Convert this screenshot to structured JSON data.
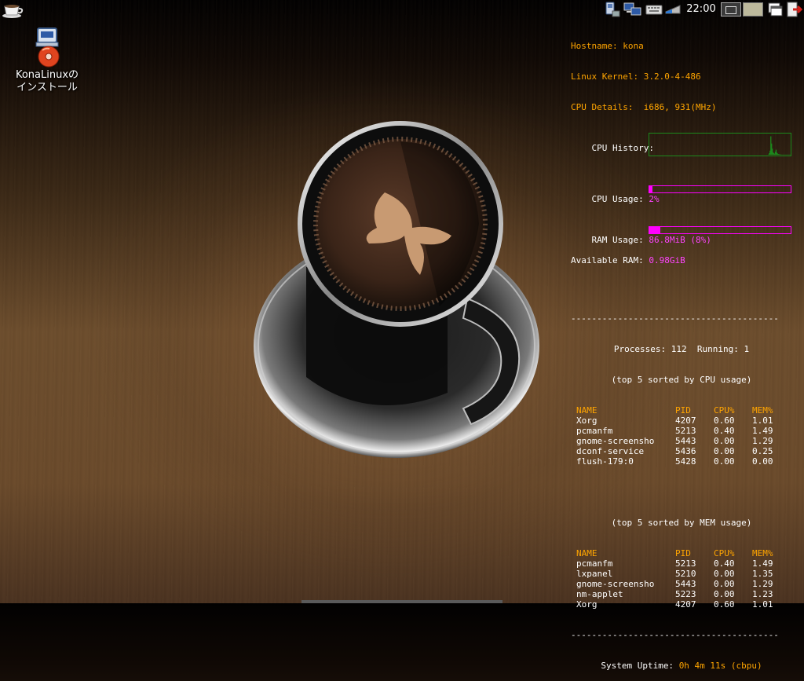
{
  "desktop": {
    "icon_label_line1": "KonaLinuxの",
    "icon_label_line2": "インストール"
  },
  "tray": {
    "clock": "22:00"
  },
  "conky": {
    "hostname_label": "Hostname:",
    "hostname": "kona",
    "kernel_label": "Linux Kernel:",
    "kernel": "3.2.0-4-486",
    "cpu_details_label": "CPU Details:",
    "cpu_details": "i686, 931(MHz)",
    "cpu_history_label": "CPU History:",
    "cpu_history": [
      0,
      0,
      0,
      0,
      0,
      0,
      0,
      0,
      0,
      0,
      0,
      0,
      0,
      0,
      0,
      0,
      0,
      0,
      0,
      0,
      0,
      0,
      0,
      0,
      0,
      0,
      0,
      0,
      0,
      0,
      0,
      0,
      0,
      0,
      0,
      0,
      0,
      0,
      0,
      0,
      0,
      0,
      0,
      0,
      0,
      0,
      0,
      0,
      0,
      0,
      0,
      0,
      0,
      0,
      0,
      0,
      0,
      0,
      0,
      0,
      0,
      0,
      0,
      0,
      0,
      0,
      0,
      0,
      0,
      0,
      0,
      0,
      0,
      0,
      0,
      0,
      0,
      0,
      0,
      0,
      0,
      0,
      0,
      0,
      0,
      0,
      0,
      0,
      0,
      0,
      0,
      0,
      0,
      0,
      0,
      0,
      0,
      0,
      0,
      0,
      0,
      0,
      0,
      0,
      0,
      0,
      0,
      0,
      0,
      0,
      0,
      0,
      0,
      0,
      0,
      0,
      0,
      0,
      0,
      0,
      0,
      0,
      0,
      0,
      0,
      0,
      0,
      0,
      0,
      0,
      0,
      0,
      0,
      0,
      0,
      0,
      0,
      0,
      0,
      0,
      0,
      0,
      0,
      0,
      0,
      0,
      0,
      0,
      0,
      0,
      0,
      0,
      0,
      0,
      0,
      0,
      0,
      0,
      2,
      8,
      20,
      90,
      55,
      30,
      12,
      8,
      5,
      15,
      25,
      10,
      6,
      4,
      3,
      2,
      2,
      1,
      1,
      1,
      1,
      1,
      1,
      1,
      1,
      1,
      1,
      1,
      1,
      1
    ],
    "cpu_usage_label": "CPU Usage:",
    "cpu_usage": "2%",
    "cpu_usage_fraction": 0.02,
    "ram_usage_label": "RAM Usage:",
    "ram_usage": "86.8MiB (8%)",
    "ram_usage_fraction": 0.08,
    "avail_ram_label": "Available RAM:",
    "avail_ram": "0.98GiB",
    "separator": "----------------------------------------",
    "processes_label": "Processes:",
    "processes": "112",
    "running_label": "Running:",
    "running": "1",
    "cpu_table_title": "(top 5 sorted by CPU usage)",
    "mem_table_title": "(top 5 sorted by MEM usage)",
    "columns": {
      "name": "NAME",
      "pid": "PID",
      "cpu": "CPU%",
      "mem": "MEM%"
    },
    "cpu_table": [
      {
        "name": "Xorg",
        "pid": "4207",
        "cpu": "0.60",
        "mem": "1.01"
      },
      {
        "name": "pcmanfm",
        "pid": "5213",
        "cpu": "0.40",
        "mem": "1.49"
      },
      {
        "name": "gnome-screensho",
        "pid": "5443",
        "cpu": "0.00",
        "mem": "1.29"
      },
      {
        "name": "dconf-service",
        "pid": "5436",
        "cpu": "0.00",
        "mem": "0.25"
      },
      {
        "name": "flush-179:0",
        "pid": "5428",
        "cpu": "0.00",
        "mem": "0.00"
      }
    ],
    "mem_table": [
      {
        "name": "pcmanfm",
        "pid": "5213",
        "cpu": "0.40",
        "mem": "1.49"
      },
      {
        "name": "lxpanel",
        "pid": "5210",
        "cpu": "0.00",
        "mem": "1.35"
      },
      {
        "name": "gnome-screensho",
        "pid": "5443",
        "cpu": "0.00",
        "mem": "1.29"
      },
      {
        "name": "nm-applet",
        "pid": "5223",
        "cpu": "0.00",
        "mem": "1.23"
      },
      {
        "name": "Xorg",
        "pid": "4207",
        "cpu": "0.60",
        "mem": "1.01"
      }
    ],
    "uptime_label": "System Uptime:",
    "uptime": "0h 4m 11s (cbpu)"
  },
  "colors": {
    "label_orange": "#ffa500",
    "value_magenta": "#ff44ff",
    "graph_green": "#1c8a1c",
    "bar_magenta": "#ff00ff"
  }
}
